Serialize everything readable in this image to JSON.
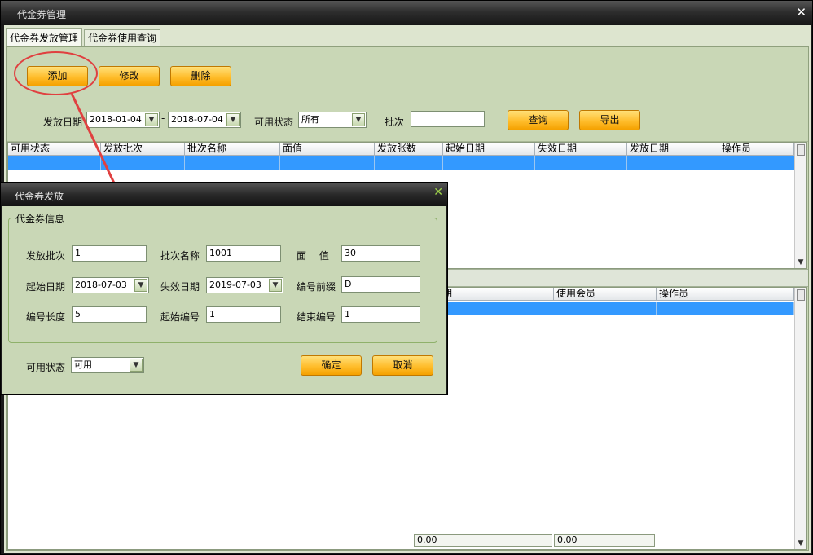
{
  "window": {
    "title": "代金券管理",
    "close_glyph": "✕"
  },
  "tabs": [
    {
      "label": "代金券发放管理"
    },
    {
      "label": "代金券使用查询"
    }
  ],
  "toolbar": {
    "add": "添加",
    "edit": "修改",
    "delete": "删除"
  },
  "filter": {
    "date_label": "发放日期",
    "date_from": "2018-01-04",
    "date_sep": "-",
    "date_to": "2018-07-04",
    "status_label": "可用状态",
    "status_value": "所有",
    "batch_label": "批次",
    "batch_value": "",
    "query": "查询",
    "export": "导出"
  },
  "grid_top": {
    "columns": [
      "可用状态",
      "发放批次",
      "批次名称",
      "面值",
      "发放张数",
      "起始日期",
      "失效日期",
      "发放日期",
      "操作员"
    ]
  },
  "grid_bottom": {
    "columns_visible": [
      "期",
      "使用会员",
      "操作员"
    ]
  },
  "summary": {
    "total1": "0.00",
    "total2": "0.00"
  },
  "dialog": {
    "title": "代金券发放",
    "group_title": "代金券信息",
    "batch_no_label": "发放批次",
    "batch_no": "1",
    "batch_name_label": "批次名称",
    "batch_name": "1001",
    "face_value_label": "面　 值",
    "face_value": "30",
    "start_date_label": "起始日期",
    "start_date": "2018-07-03",
    "expire_date_label": "失效日期",
    "expire_date": "2019-07-03",
    "prefix_label": "编号前缀",
    "prefix": "D",
    "length_label": "编号长度",
    "length": "5",
    "start_no_label": "起始编号",
    "start_no": "1",
    "end_no_label": "结束编号",
    "end_no": "1",
    "status_label": "可用状态",
    "status": "可用",
    "ok": "确定",
    "cancel": "取消"
  },
  "colors": {
    "accent_orange": "#ffbd2c",
    "selection_blue": "#3399ff",
    "panel_green": "#c9d7b6",
    "annotation_red": "#e04040"
  },
  "icons": [
    "close-icon",
    "dropdown-arrow-icon",
    "scroll-down-icon"
  ]
}
